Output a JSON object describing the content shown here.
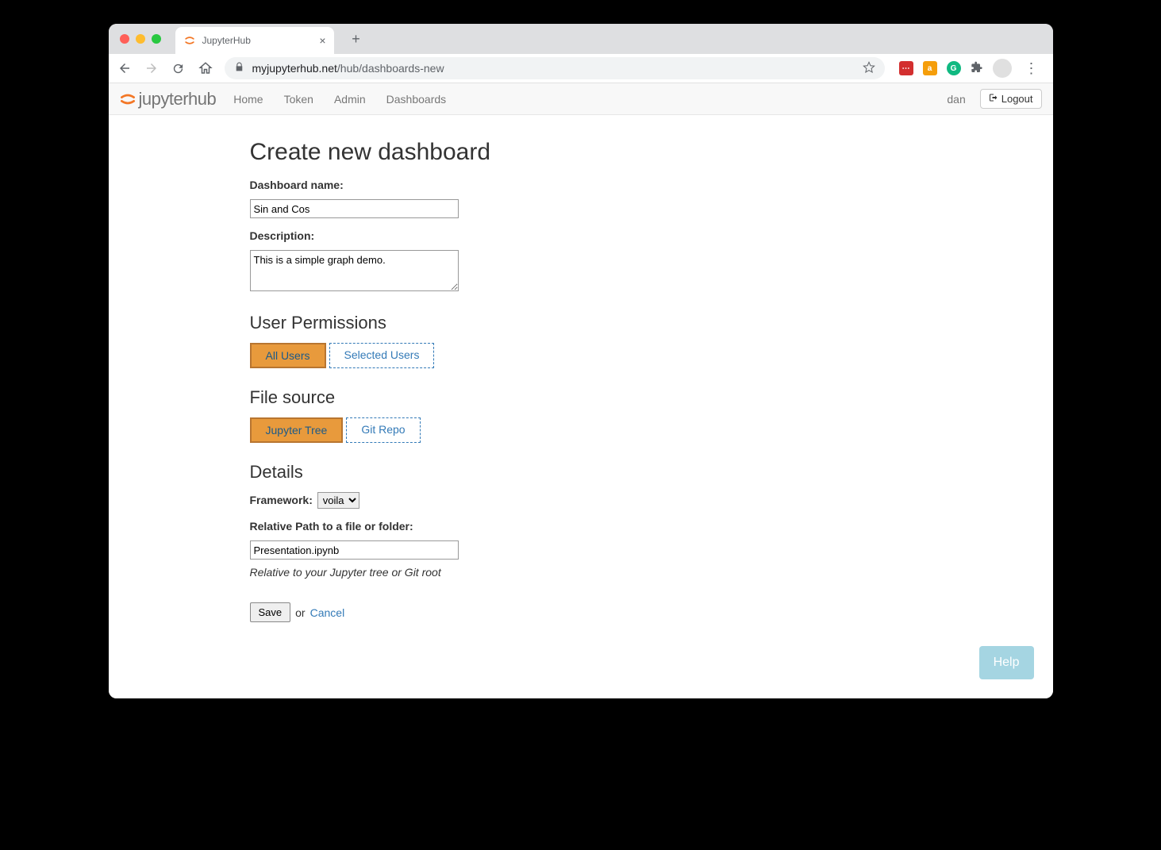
{
  "browser": {
    "tab_title": "JupyterHub",
    "url_host": "myjupyterhub.net",
    "url_path": "/hub/dashboards-new"
  },
  "navbar": {
    "logo_text": "jupyterhub",
    "links": [
      "Home",
      "Token",
      "Admin",
      "Dashboards"
    ],
    "user": "dan",
    "logout": "Logout"
  },
  "form": {
    "title": "Create new dashboard",
    "name_label": "Dashboard name:",
    "name_value": "Sin and Cos",
    "desc_label": "Description:",
    "desc_value": "This is a simple graph demo.",
    "permissions_heading": "User Permissions",
    "permissions": {
      "all": "All Users",
      "selected": "Selected Users"
    },
    "filesource_heading": "File source",
    "filesource": {
      "tree": "Jupyter Tree",
      "git": "Git Repo"
    },
    "details_heading": "Details",
    "framework_label": "Framework:",
    "framework_value": "voila",
    "relpath_label": "Relative Path to a file or folder:",
    "relpath_value": "Presentation.ipynb",
    "relpath_hint": "Relative to your Jupyter tree or Git root",
    "save": "Save",
    "or": "or",
    "cancel": "Cancel"
  },
  "help": "Help"
}
